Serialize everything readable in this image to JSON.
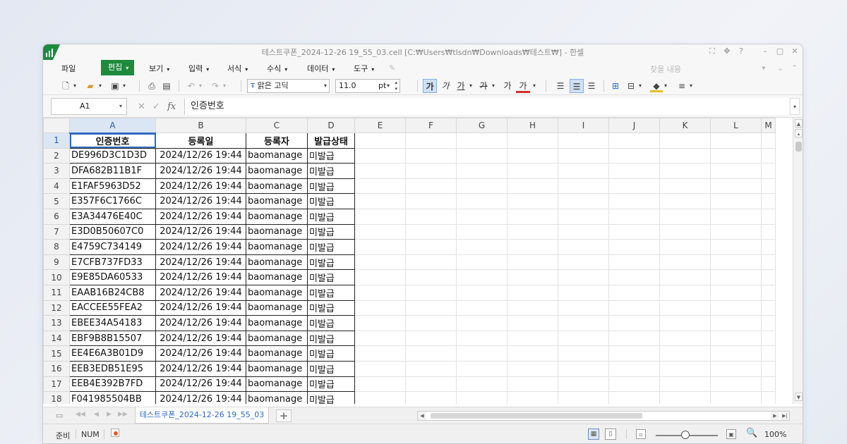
{
  "window": {
    "title": "테스트쿠폰_2024-12-26 19_55_03.cell [C:₩Users₩tlsdn₩Downloads₩테스트₩] - 한셀",
    "controls": [
      "⛶",
      "✥",
      "?",
      "–",
      "▢",
      "✕"
    ]
  },
  "menu": {
    "items": [
      {
        "label": "파일",
        "dd": ""
      },
      {
        "label": "편집",
        "dd": "▾"
      },
      {
        "label": "보기",
        "dd": "▾"
      },
      {
        "label": "입력",
        "dd": "▾"
      },
      {
        "label": "서식",
        "dd": "▾"
      },
      {
        "label": "수식",
        "dd": "▾"
      },
      {
        "label": "데이터",
        "dd": "▾"
      },
      {
        "label": "도구",
        "dd": "▾"
      }
    ],
    "search_label": "찾을 내용"
  },
  "toolbar": {
    "font_name": "맑은 고딕",
    "font_size": "11.0",
    "font_unit": "pt"
  },
  "formula_bar": {
    "cell_ref": "A1",
    "fx_label": "fx",
    "content": "인증번호"
  },
  "sheet": {
    "columns": [
      "A",
      "B",
      "C",
      "D",
      "E",
      "F",
      "G",
      "H",
      "I",
      "J",
      "K",
      "L",
      "M"
    ],
    "header_row": [
      "인증번호",
      "등록일",
      "등록자",
      "발급상태"
    ],
    "rows": [
      [
        "DE996D3C1D3D",
        "2024/12/26 19:44",
        "baomanage",
        "미발급"
      ],
      [
        "DFA682B11B1F",
        "2024/12/26 19:44",
        "baomanage",
        "미발급"
      ],
      [
        "E1FAF5963D52",
        "2024/12/26 19:44",
        "baomanage",
        "미발급"
      ],
      [
        "E357F6C1766C",
        "2024/12/26 19:44",
        "baomanage",
        "미발급"
      ],
      [
        "E3A34476E40C",
        "2024/12/26 19:44",
        "baomanage",
        "미발급"
      ],
      [
        "E3D0B50607C0",
        "2024/12/26 19:44",
        "baomanage",
        "미발급"
      ],
      [
        "E4759C734149",
        "2024/12/26 19:44",
        "baomanage",
        "미발급"
      ],
      [
        "E7CFB737FD33",
        "2024/12/26 19:44",
        "baomanage",
        "미발급"
      ],
      [
        "E9E85DA60533",
        "2024/12/26 19:44",
        "baomanage",
        "미발급"
      ],
      [
        "EAAB16B24CB8",
        "2024/12/26 19:44",
        "baomanage",
        "미발급"
      ],
      [
        "EACCEE55FEA2",
        "2024/12/26 19:44",
        "baomanage",
        "미발급"
      ],
      [
        "EBEE34A54183",
        "2024/12/26 19:44",
        "baomanage",
        "미발급"
      ],
      [
        "EBF9B8B15507",
        "2024/12/26 19:44",
        "baomanage",
        "미발급"
      ],
      [
        "EE4E6A3B01D9",
        "2024/12/26 19:44",
        "baomanage",
        "미발급"
      ],
      [
        "EEB3EDB51E95",
        "2024/12/26 19:44",
        "baomanage",
        "미발급"
      ],
      [
        "EEB4E392B7FD",
        "2024/12/26 19:44",
        "baomanage",
        "미발급"
      ],
      [
        "F041985504BB",
        "2024/12/26 19:44",
        "baomanage",
        "미발급"
      ]
    ]
  },
  "tabs": {
    "sheet_name": "테스트쿠폰_2024-12-26 19_55_03",
    "add": "+"
  },
  "status": {
    "mode": "준비",
    "num": "NUM",
    "zoom": "100%"
  },
  "colors": {
    "accent": "#1e8a3e",
    "selection": "#2f6bc1",
    "tab_text": "#2a6ac8"
  }
}
